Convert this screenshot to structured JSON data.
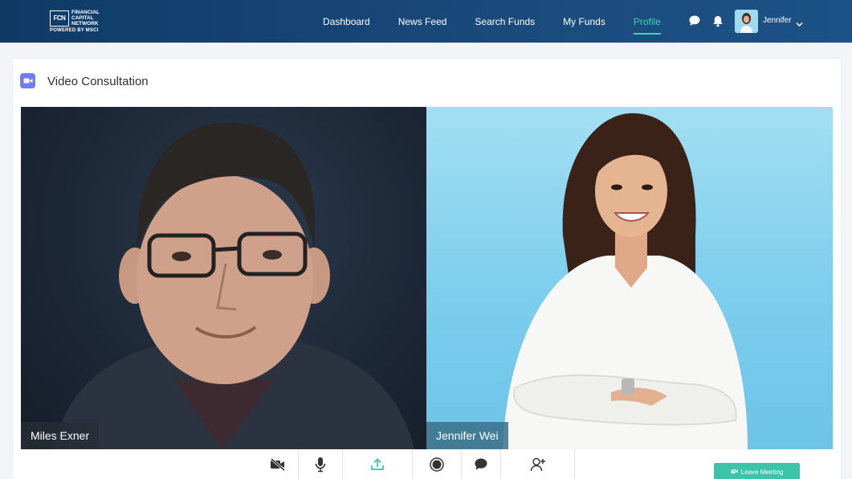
{
  "brand": {
    "logo_mark": "FCN",
    "name_line1": "FINANCIAL",
    "name_line2": "CAPITAL",
    "name_line3": "NETWORK",
    "powered_by": "POWERED BY MSCI"
  },
  "nav": {
    "items": [
      {
        "label": "Dashboard"
      },
      {
        "label": "News Feed"
      },
      {
        "label": "Search Funds"
      },
      {
        "label": "My Funds"
      },
      {
        "label": "Profile",
        "active": true
      }
    ],
    "icons": [
      "chat-icon",
      "bell-icon"
    ],
    "user_name": "Jennifer"
  },
  "page": {
    "title": "Video Consultation",
    "title_icon": "video-camera-icon"
  },
  "participants": [
    {
      "name": "Miles Exner"
    },
    {
      "name": "Jennifer Wei"
    }
  ],
  "controls": [
    {
      "icon": "video-off-icon"
    },
    {
      "icon": "microphone-icon"
    },
    {
      "icon": "share-screen-icon"
    },
    {
      "icon": "record-icon"
    },
    {
      "icon": "chat-icon"
    },
    {
      "icon": "add-participant-icon"
    }
  ],
  "leave": {
    "label": "Leave Meeting",
    "icon": "video-off-icon"
  },
  "colors": {
    "nav_bg": "#0f3a66",
    "accent": "#3fd2b6",
    "leave_button": "#3cc4aa",
    "title_icon_bg": "#6f7bf7"
  }
}
